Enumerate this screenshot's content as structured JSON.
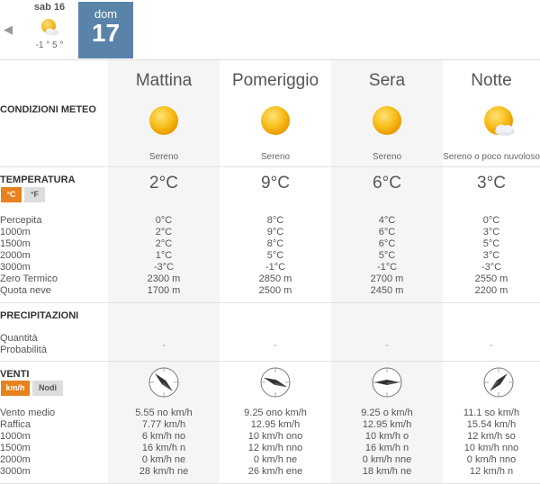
{
  "days": {
    "prev": {
      "name": "sab 16",
      "temps": "-1 ° 5 °",
      "icon": "sun-cloud-icon"
    },
    "current": {
      "name": "dom",
      "number": "17"
    },
    "prev_arrow": "◀"
  },
  "sections": {
    "conditions": "CONDIZIONI METEO",
    "temperature": "TEMPERATURA",
    "precipitation": "PRECIPITAZIONI",
    "wind": "VENTI"
  },
  "temp_units": {
    "celsius": "°C",
    "fahrenheit": "°F"
  },
  "wind_units": {
    "kmh": "km/h",
    "knots": "Nodi"
  },
  "temp_row_labels": [
    "Percepita",
    "1000m",
    "1500m",
    "2000m",
    "3000m",
    "Zero Termico",
    "Quota neve"
  ],
  "precip_row_labels": [
    "Quantità",
    "Probabilità"
  ],
  "wind_row_labels": [
    "Vento medio",
    "Raffica",
    "1000m",
    "1500m",
    "2000m",
    "3000m"
  ],
  "periods": [
    {
      "name": "Mattina",
      "condition": "Sereno",
      "icon": "sun-icon",
      "temp": "2°C",
      "temp_rows": [
        "0°C",
        "2°C",
        "2°C",
        "1°C",
        "-3°C",
        "2300 m",
        "1700 m"
      ],
      "precip": "-",
      "wind_dir": 135,
      "wind_rows": [
        "5.55 no km/h",
        "7.77 km/h",
        "6 km/h no",
        "16 km/h n",
        "0 km/h ne",
        "28 km/h ne"
      ]
    },
    {
      "name": "Pomeriggio",
      "condition": "Sereno",
      "icon": "sun-icon",
      "temp": "9°C",
      "temp_rows": [
        "8°C",
        "9°C",
        "8°C",
        "5°C",
        "-1°C",
        "2850 m",
        "2500 m"
      ],
      "precip": "-",
      "wind_dir": 112,
      "wind_rows": [
        "9.25 ono km/h",
        "12.95 km/h",
        "10 km/h ono",
        "12 km/h nno",
        "0 km/h ne",
        "26 km/h ene"
      ]
    },
    {
      "name": "Sera",
      "condition": "Sereno",
      "icon": "sun-icon",
      "temp": "6°C",
      "temp_rows": [
        "4°C",
        "6°C",
        "6°C",
        "5°C",
        "-1°C",
        "2700 m",
        "2450 m"
      ],
      "precip": "-",
      "wind_dir": 90,
      "wind_rows": [
        "9.25 o km/h",
        "12.95 km/h",
        "10 km/h o",
        "16 km/h n",
        "0 km/h nne",
        "18 km/h ne"
      ]
    },
    {
      "name": "Notte",
      "condition": "Sereno o poco nuvoloso",
      "icon": "sun-cloud-icon",
      "temp": "3°C",
      "temp_rows": [
        "0°C",
        "3°C",
        "5°C",
        "3°C",
        "-3°C",
        "2550 m",
        "2200 m"
      ],
      "precip": "-",
      "wind_dir": 225,
      "wind_rows": [
        "11.1 so km/h",
        "15.54 km/h",
        "12 km/h so",
        "10 km/h nno",
        "0 km/h nno",
        "12 km/h n"
      ]
    }
  ],
  "colors": {
    "accent": "#e8821f",
    "current_day": "#5a83aa",
    "sun": "#f6b71e"
  }
}
